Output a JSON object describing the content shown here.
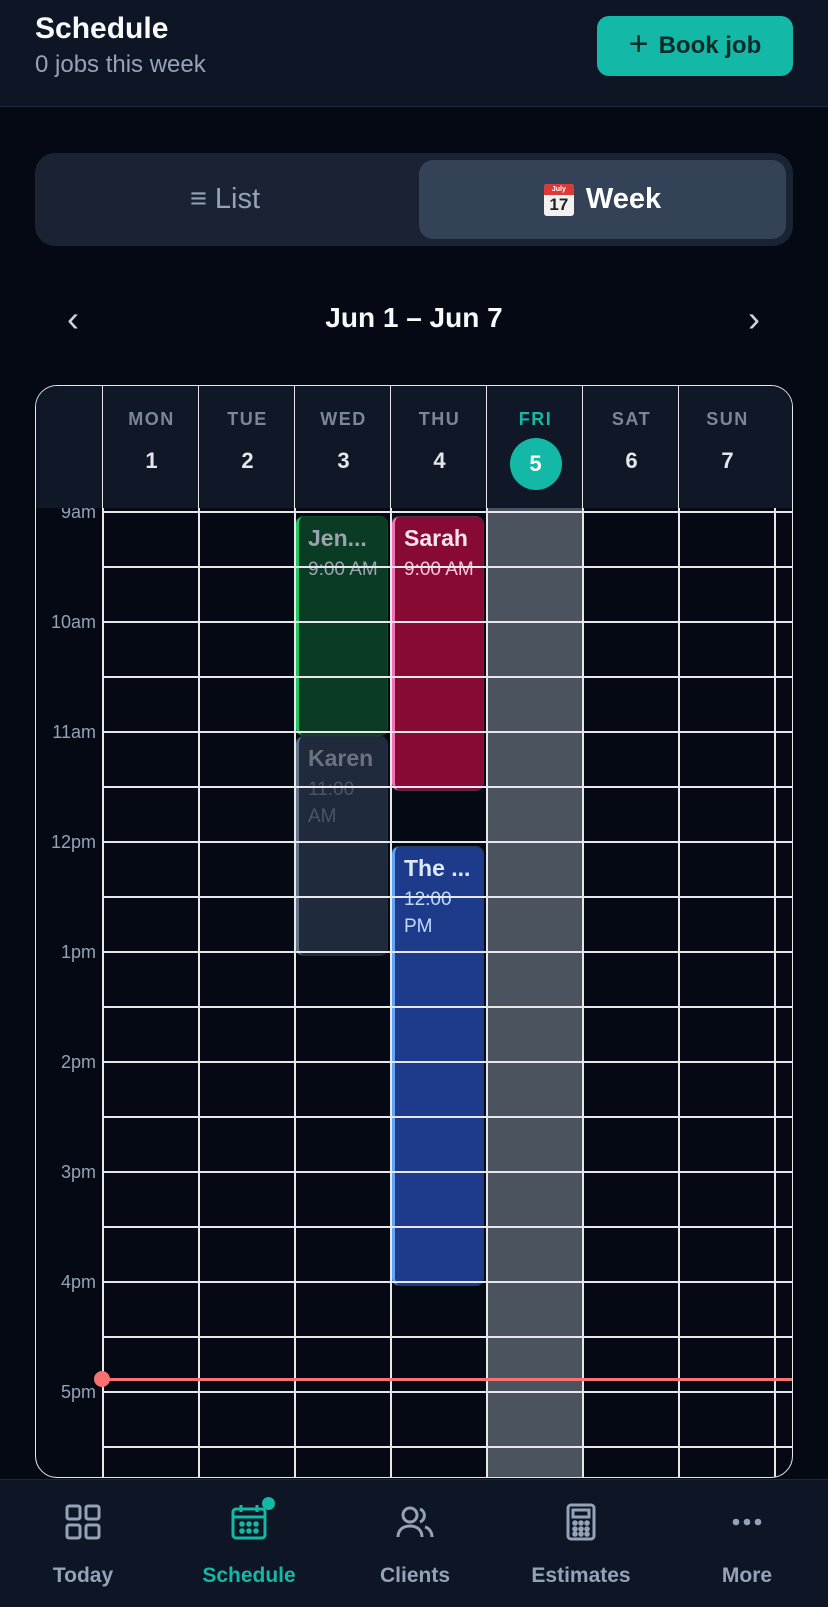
{
  "header": {
    "title": "Schedule",
    "subtitle": "0 jobs this week",
    "book_button": "Book job",
    "book_icon": "plus-icon"
  },
  "view_toggle": {
    "list_label": "≡ List",
    "week_label": "Week",
    "selected": "Week",
    "week_icon": "calendar-icon",
    "week_icon_month": "July",
    "week_icon_day": "17"
  },
  "week_nav": {
    "range": "Jun 1 – Jun 7",
    "prev_icon": "chevron-left-icon",
    "next_icon": "chevron-right-icon",
    "prev": "‹",
    "next": "›"
  },
  "days": [
    {
      "name": "MON",
      "num": "1",
      "today": false
    },
    {
      "name": "TUE",
      "num": "2",
      "today": false
    },
    {
      "name": "WED",
      "num": "3",
      "today": false
    },
    {
      "name": "THU",
      "num": "4",
      "today": false
    },
    {
      "name": "FRI",
      "num": "5",
      "today": true
    },
    {
      "name": "SAT",
      "num": "6",
      "today": false
    },
    {
      "name": "SUN",
      "num": "7",
      "today": false
    }
  ],
  "hours": [
    "9am",
    "10am",
    "11am",
    "12pm",
    "1pm",
    "2pm",
    "3pm",
    "4pm",
    "5pm"
  ],
  "visible_start_hour": 8.95,
  "events": [
    {
      "name": "Jen...",
      "time": "9:00 AM",
      "day": 2,
      "start": 9,
      "end": 11,
      "bg": "#0a3b25",
      "border": "#22c55e",
      "text": "#9ca3af",
      "name_color": "#9ca3af"
    },
    {
      "name": "Karen",
      "time": "11:00 AM",
      "day": 2,
      "start": 11,
      "end": 13,
      "bg": "#1f2a3d",
      "border": "#64748b",
      "text": "#4b5563",
      "name_color": "#6b7280"
    },
    {
      "name": "Sarah",
      "time": "9:00 AM",
      "day": 3,
      "start": 9,
      "end": 11.5,
      "bg": "#870a35",
      "border": "#f472b6",
      "text": "#f3c5d6",
      "name_color": "#fbe4ee"
    },
    {
      "name": "The ...",
      "time": "12:00 PM",
      "day": 3,
      "start": 12,
      "end": 16,
      "bg": "#1e3a8a",
      "border": "#60a5fa",
      "text": "#bfdbfe",
      "name_color": "#dbeafe"
    }
  ],
  "current_time_hour": 16.87,
  "colors": {
    "accent": "#14b8a6",
    "now_line": "#f87171",
    "today_column": "#4b535f"
  },
  "tabs": [
    {
      "label": "Today",
      "icon": "grid-icon",
      "active": false
    },
    {
      "label": "Schedule",
      "icon": "calendar-icon",
      "active": true,
      "badge": true
    },
    {
      "label": "Clients",
      "icon": "users-icon",
      "active": false
    },
    {
      "label": "Estimates",
      "icon": "calculator-icon",
      "active": false
    },
    {
      "label": "More",
      "icon": "more-icon",
      "active": false
    }
  ]
}
